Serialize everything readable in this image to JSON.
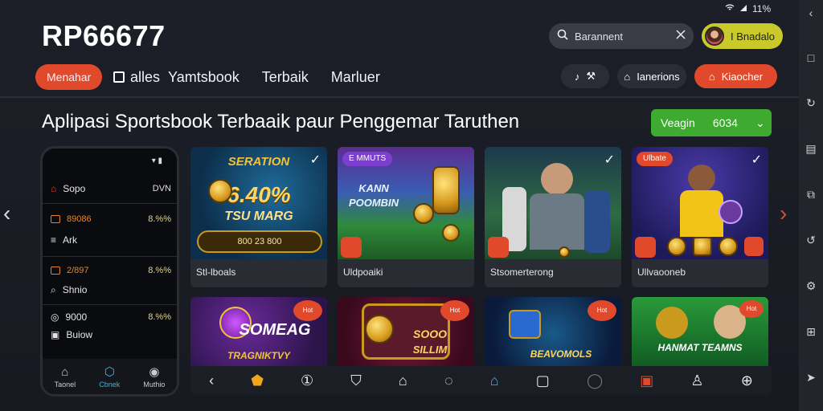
{
  "app": {
    "logo": "RP66677"
  },
  "status": {
    "battery": "11%"
  },
  "search": {
    "placeholder": "Barannent"
  },
  "user": {
    "label": "I Bnadalo"
  },
  "nav": {
    "tabs": [
      "Menahar",
      "alles",
      "Yamtsbook",
      "Terbaik",
      "Marluer"
    ],
    "buttons": [
      "",
      "Ianerions",
      "Kiaocher"
    ]
  },
  "heading": "Aplipasi Sportsbook Terbaaik paur Penggemar Taruthen",
  "cta": {
    "label": "Veagin",
    "value": "6034"
  },
  "phone": {
    "rows": [
      {
        "label": "Sopo",
        "value": "DVN"
      },
      {
        "label": "89086",
        "value": "8.%%"
      },
      {
        "label": "Ark",
        "value": ""
      },
      {
        "label": "2/897",
        "value": "8.%%"
      },
      {
        "label": "Shnio",
        "value": ""
      },
      {
        "label": "9000",
        "value": "8.%%"
      },
      {
        "label": "Buiow",
        "value": ""
      }
    ],
    "nav": [
      "Taonel",
      "Cbnek",
      "Muthio"
    ]
  },
  "cards": [
    {
      "title": "SERATION",
      "big": "6.40%",
      "sub": "TSU MARG",
      "score": "800 23 800",
      "caption": "Stl-lboals"
    },
    {
      "title": "E MMUTS",
      "big": "KANN",
      "sub": "POOMBIN",
      "caption": "Uldpoaiki"
    },
    {
      "caption": "Stsomerterong"
    },
    {
      "title": "Ulbate",
      "caption": "Ullvaooneb"
    }
  ],
  "tiles": [
    {
      "title": "SOMEAG",
      "sub": "TRAGNIKTVY"
    },
    {
      "title": "SOOO",
      "sub": "SILLIM"
    },
    {
      "title": "BEAVOMOLS",
      "sub": ""
    },
    {
      "title": "HANMAT TEAMNS",
      "sub": ""
    }
  ],
  "badges": {
    "hot": "Hot"
  }
}
